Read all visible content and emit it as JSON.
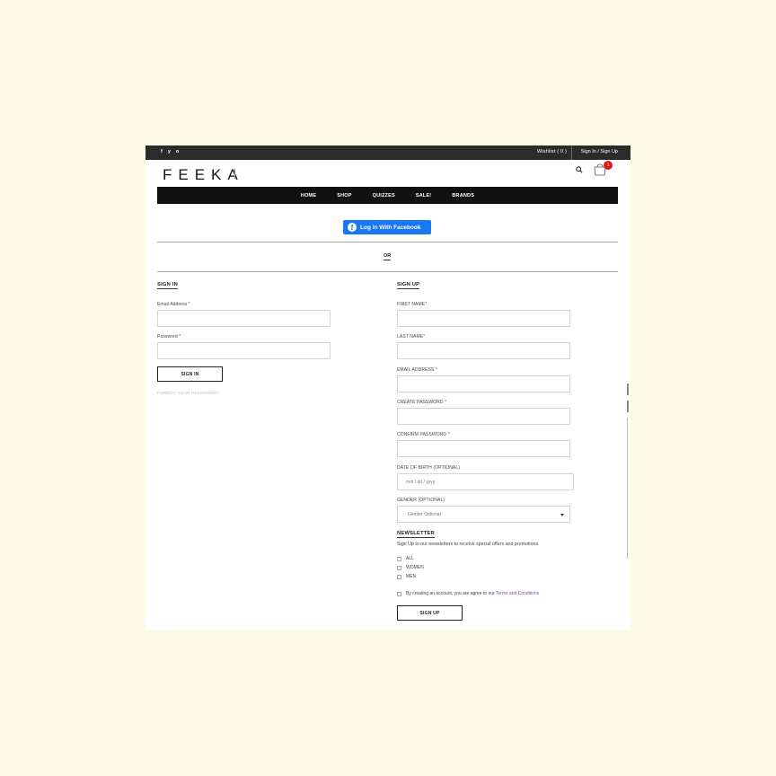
{
  "topbar": {
    "social": [
      "f",
      "y",
      "o"
    ],
    "wishlist": "Wishlist ( 0 )",
    "signin_signup": "Sign In / Sign Up"
  },
  "header": {
    "logo": "FEEKA",
    "cart_count": "1"
  },
  "nav": {
    "items": [
      "HOME",
      "SHOP",
      "QUIZZES",
      "SALE!",
      "BRANDS"
    ]
  },
  "facebook": {
    "label": "Log in With Facebook"
  },
  "divider_or": "OR",
  "signin": {
    "title": "SIGN IN",
    "email_label": "Email Address",
    "password_label": "Password",
    "button": "SIGN IN",
    "forgot": "FORGOT YOUR PASSWORD?"
  },
  "signup": {
    "title": "SIGN UP",
    "first_name_label": "FIRST NAME",
    "last_name_label": "LAST NAME",
    "email_label": "EMAIL ADDRESS",
    "create_password_label": "CREATE PASSWORD",
    "confirm_password_label": "CONFIRM PASSWORD",
    "dob_label": "DATE OF BIRTH (OPTIONAL)",
    "dob_placeholder": "mm / dd / yyyy",
    "gender_label": "GENDER (OPTIONAL)",
    "gender_selected": "Gender Optional",
    "newsletter_title": "NEWSLETTER",
    "newsletter_desc": "Sign Up to our newsletters to receive special offers and promotions.",
    "newsletter_options": [
      "ALL",
      "WOMEN",
      "MEN"
    ],
    "terms_text": "By creating an account, you are agree to our",
    "terms_link": "Terms and Conditions",
    "button": "SIGN UP"
  },
  "required_mark": "*",
  "colors": {
    "background": "#fcf9e9",
    "topbar": "#2b2b2b",
    "nav": "#111111",
    "facebook": "#1877f2",
    "badge": "#e01818",
    "required": "#dd2222",
    "link": "#8b4aa8"
  }
}
